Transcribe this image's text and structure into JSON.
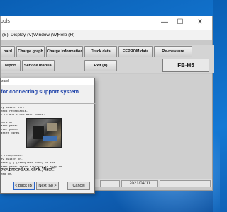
{
  "app": {
    "title": "ools",
    "controls": {
      "minimize": "—",
      "maximize": "☐",
      "close": "✕"
    }
  },
  "menu": {
    "items": [
      {
        "label": "(S)"
      },
      {
        "label": "Display (V)"
      },
      {
        "label": "Window (W)"
      },
      {
        "label": "Help (H)"
      }
    ]
  },
  "toolbar": {
    "row1": [
      {
        "label": "oard"
      },
      {
        "label": "Charge graph"
      },
      {
        "label": "Charge information"
      },
      {
        "label": "Truck data"
      },
      {
        "label": "EEPROM data"
      },
      {
        "label": "Re-measure"
      }
    ],
    "row2": [
      {
        "label": "report"
      },
      {
        "label": "Service manual"
      },
      {
        "label": "Exit (X)"
      }
    ],
    "model_badge": "FB-H5"
  },
  "status": {
    "date": "2021/04/11"
  },
  "wizard": {
    "title": "izard",
    "heading": "for connecting support system",
    "instructions": [
      "ey switch off.",
      "nect receptacle,",
      "e PC and truck with cable.",
      "",
      "nart of",
      "ator pedal",
      "eter panel",
      "aster panel"
    ],
    "lower_instructions": [
      "e receptacle.",
      "ey switch on.",
      "here [ ] (sandglass icon) on the",
      "eter panel stars blinking to stay on",
      "l 5 seconds after the key switch",
      "ned on."
    ],
    "bottom_text": "ove procedure, click \"Next\".",
    "buttons": {
      "back": "< Back (B)",
      "next": "Next (N) >",
      "cancel": "Cancel"
    }
  }
}
